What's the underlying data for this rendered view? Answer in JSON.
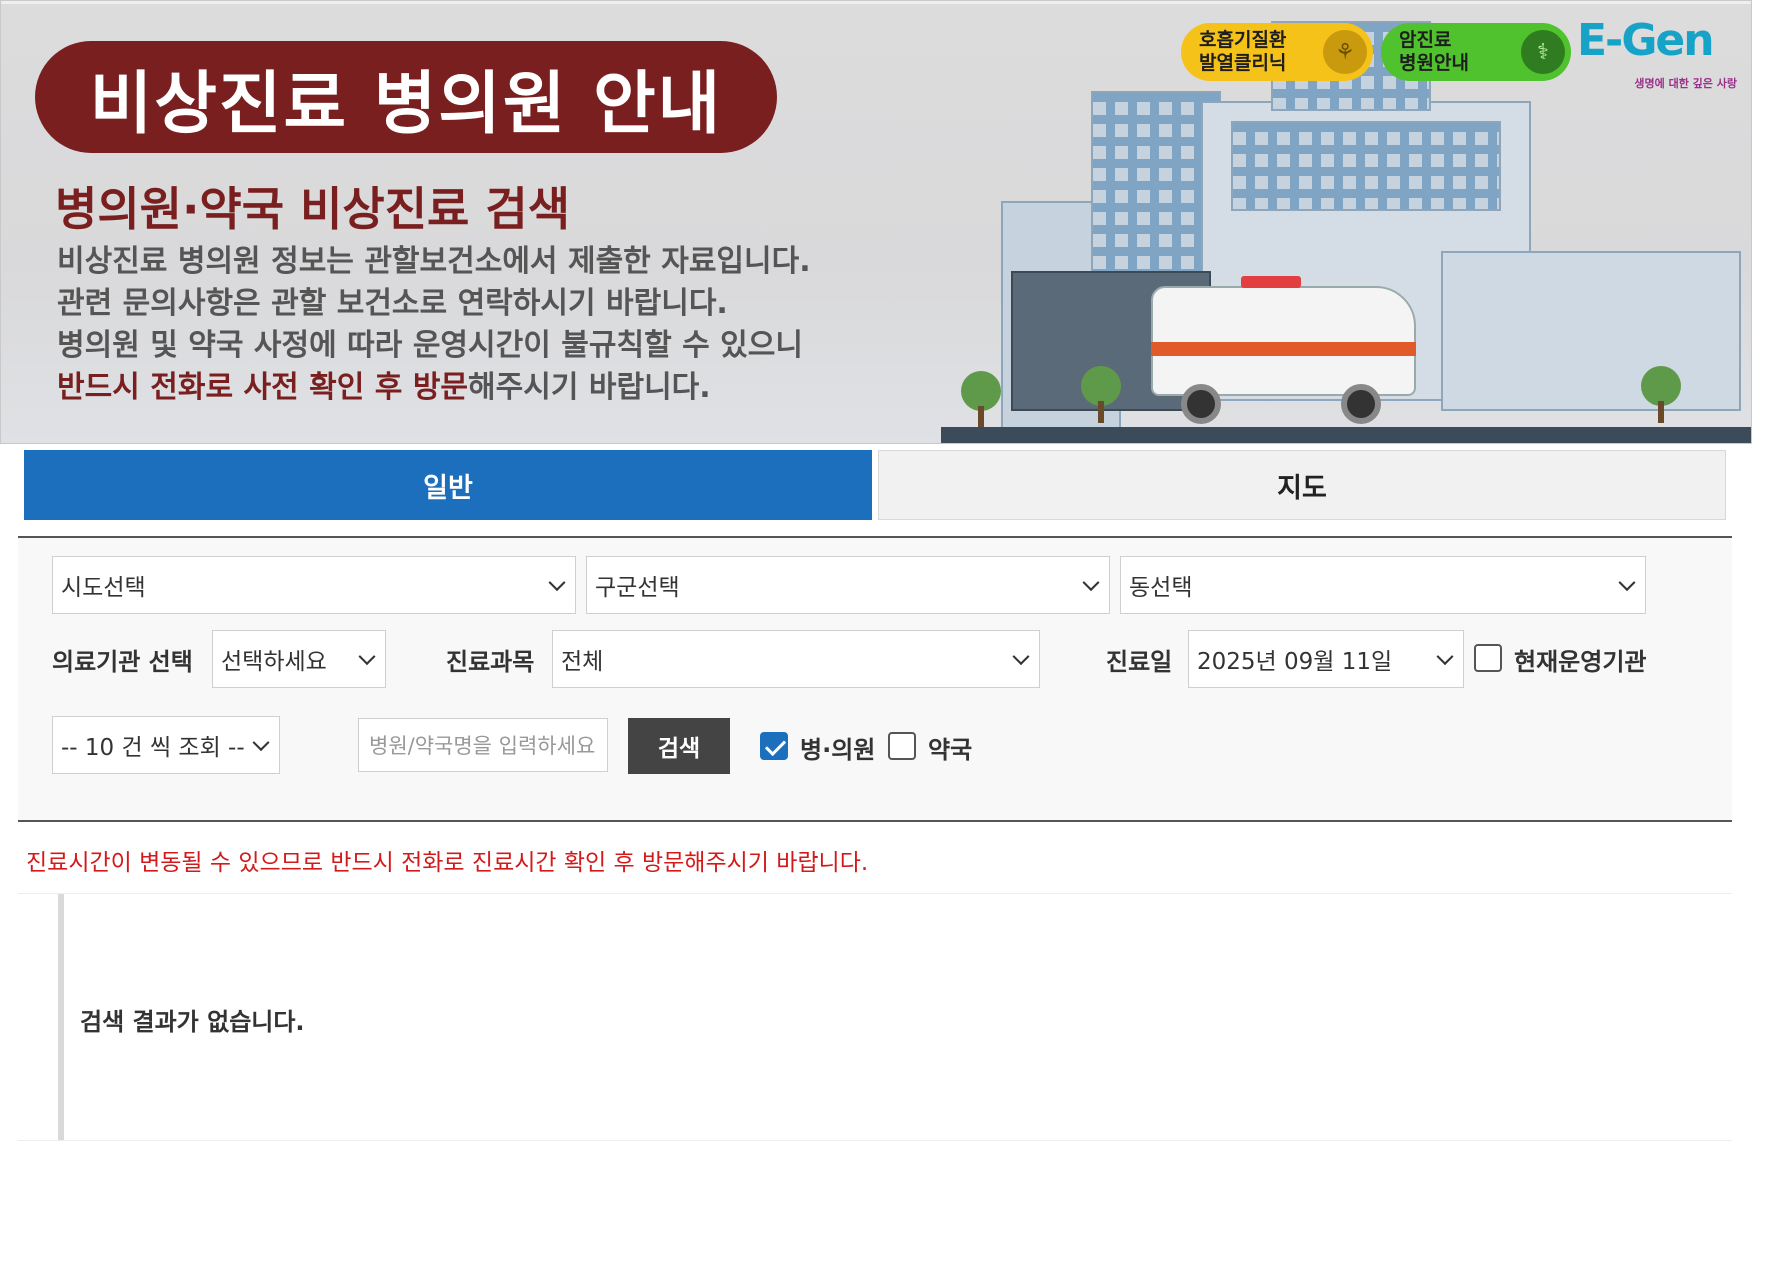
{
  "banner": {
    "title": "비상진료 병의원 안내",
    "subtitle": "병의원·약국 비상진료 검색",
    "lines": [
      "비상진료 병의원 정보는 관할보건소에서 제출한 자료입니다.",
      "관련 문의사항은 관할 보건소로 연락하시기 바랍니다.",
      "병의원 및 약국 사정에 따라 운영시간이 불규칙할 수 있으니"
    ],
    "line4_em": "반드시 전화로 사전 확인 후 방문",
    "line4_rest": "해주시기 바랍니다.",
    "badge_respiratory": "호흡기질환\n발열클리닉",
    "badge_cancer": "암진료\n병원안내",
    "logo_text": "E-Gen",
    "logo_sub": "생명에 대한 깊은 사랑",
    "colors": {
      "title_bg": "#7a1f1f",
      "badge_yellow": "#f5c21a",
      "badge_green": "#4fc22e"
    }
  },
  "tabs": {
    "general": "일반",
    "map": "지도",
    "active": "general",
    "active_color": "#1b6fbc"
  },
  "filters": {
    "sido": "시도선택",
    "gugun": "구군선택",
    "dong": "동선택",
    "institution_label": "의료기관 선택",
    "institution_value": "선택하세요",
    "department_label": "진료과목",
    "department_value": "전체",
    "date_label": "진료일",
    "date_value": "2025년 09월 11일",
    "operating_now_label": "현재운영기관",
    "operating_now_checked": false,
    "page_size": "-- 10 건 씩 조회 --",
    "name_placeholder": "병원/약국명을 입력하세요",
    "search_button": "검색",
    "hospital_label": "병·의원",
    "hospital_checked": true,
    "pharmacy_label": "약국",
    "pharmacy_checked": false
  },
  "notice": "진료시간이 변동될 수 있으므로 반드시 전화로 진료시간 확인 후 방문해주시기 바랍니다.",
  "results": {
    "empty_message": "검색 결과가 없습니다."
  }
}
